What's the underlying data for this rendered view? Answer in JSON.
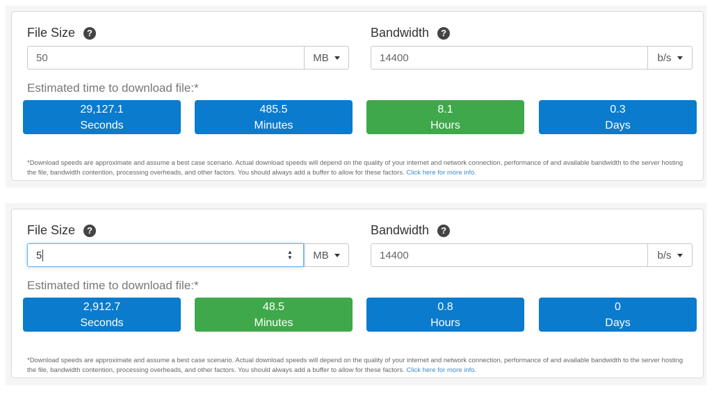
{
  "colors": {
    "blue_tile": "#0a7bcd",
    "green_tile": "#3fa84a",
    "link": "#3a8cd0"
  },
  "calculators": [
    {
      "file_size_label": "File Size",
      "bandwidth_label": "Bandwidth",
      "file_size_value": "50",
      "file_size_unit": "MB",
      "bandwidth_value": "14400",
      "bandwidth_unit": "b/s",
      "estimate_label": "Estimated time to download file:*",
      "results": [
        {
          "value": "29,127.1",
          "unit": "Seconds",
          "highlight": false
        },
        {
          "value": "485.5",
          "unit": "Minutes",
          "highlight": false
        },
        {
          "value": "8.1",
          "unit": "Hours",
          "highlight": true
        },
        {
          "value": "0.3",
          "unit": "Days",
          "highlight": false
        }
      ],
      "disclaimer": "*Download speeds are approximate and assume a best case scenario. Actual download speeds will depend on the quality of your internet and network connection, performance of and available bandwidth to the server hosting the file, bandwidth contention, processing overheads, and other factors. You should always add a buffer to allow for these factors.",
      "more_info_link": "Click here for more info."
    },
    {
      "file_size_label": "File Size",
      "bandwidth_label": "Bandwidth",
      "file_size_value": "5",
      "file_size_unit": "MB",
      "bandwidth_value": "14400",
      "bandwidth_unit": "b/s",
      "estimate_label": "Estimated time to download file:*",
      "results": [
        {
          "value": "2,912.7",
          "unit": "Seconds",
          "highlight": false
        },
        {
          "value": "48.5",
          "unit": "Minutes",
          "highlight": true
        },
        {
          "value": "0.8",
          "unit": "Hours",
          "highlight": false
        },
        {
          "value": "0",
          "unit": "Days",
          "highlight": false
        }
      ],
      "disclaimer": "*Download speeds are approximate and assume a best case scenario. Actual download speeds will depend on the quality of your internet and network connection, performance of and available bandwidth to the server hosting the file, bandwidth contention, processing overheads, and other factors. You should always add a buffer to allow for these factors.",
      "more_info_link": "Click here for more info."
    }
  ]
}
